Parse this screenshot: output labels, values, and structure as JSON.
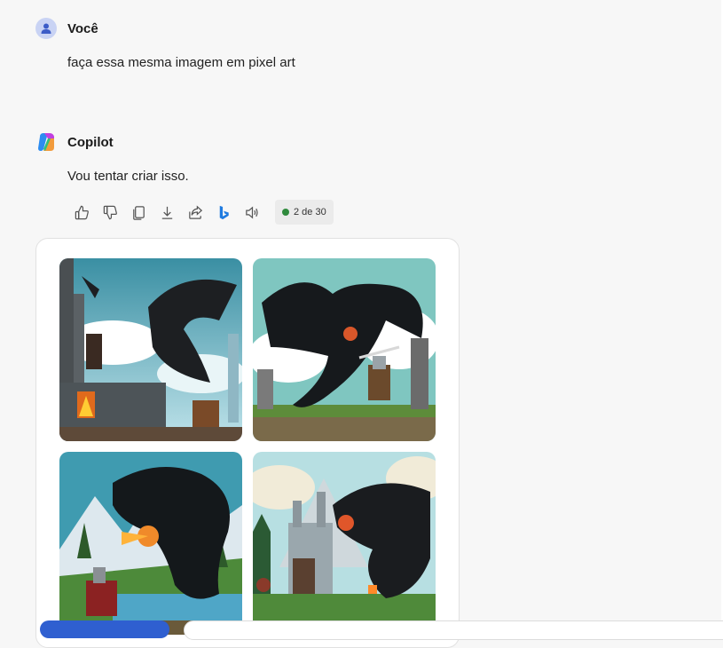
{
  "user_message": {
    "author": "Você",
    "text": "faça essa mesma imagem em pixel art"
  },
  "copilot_message": {
    "author": "Copilot",
    "text": "Vou tentar criar isso."
  },
  "actions": {
    "icons": [
      "thumbs-up-icon",
      "thumbs-down-icon",
      "copy-icon",
      "download-icon",
      "share-icon",
      "bing-icon",
      "read-aloud-icon"
    ],
    "counter": "2 de 30"
  },
  "images": [
    {
      "subject": "pixel art knight and dragon on castle wall"
    },
    {
      "subject": "pixel art knight fighting black dragon"
    },
    {
      "subject": "pixel art dragon breathing fire at knight in mountains"
    },
    {
      "subject": "pixel art dragon and knight before castle"
    }
  ],
  "colors": {
    "accent_blue": "#2f5fd0",
    "status_green": "#2f8a3d"
  }
}
